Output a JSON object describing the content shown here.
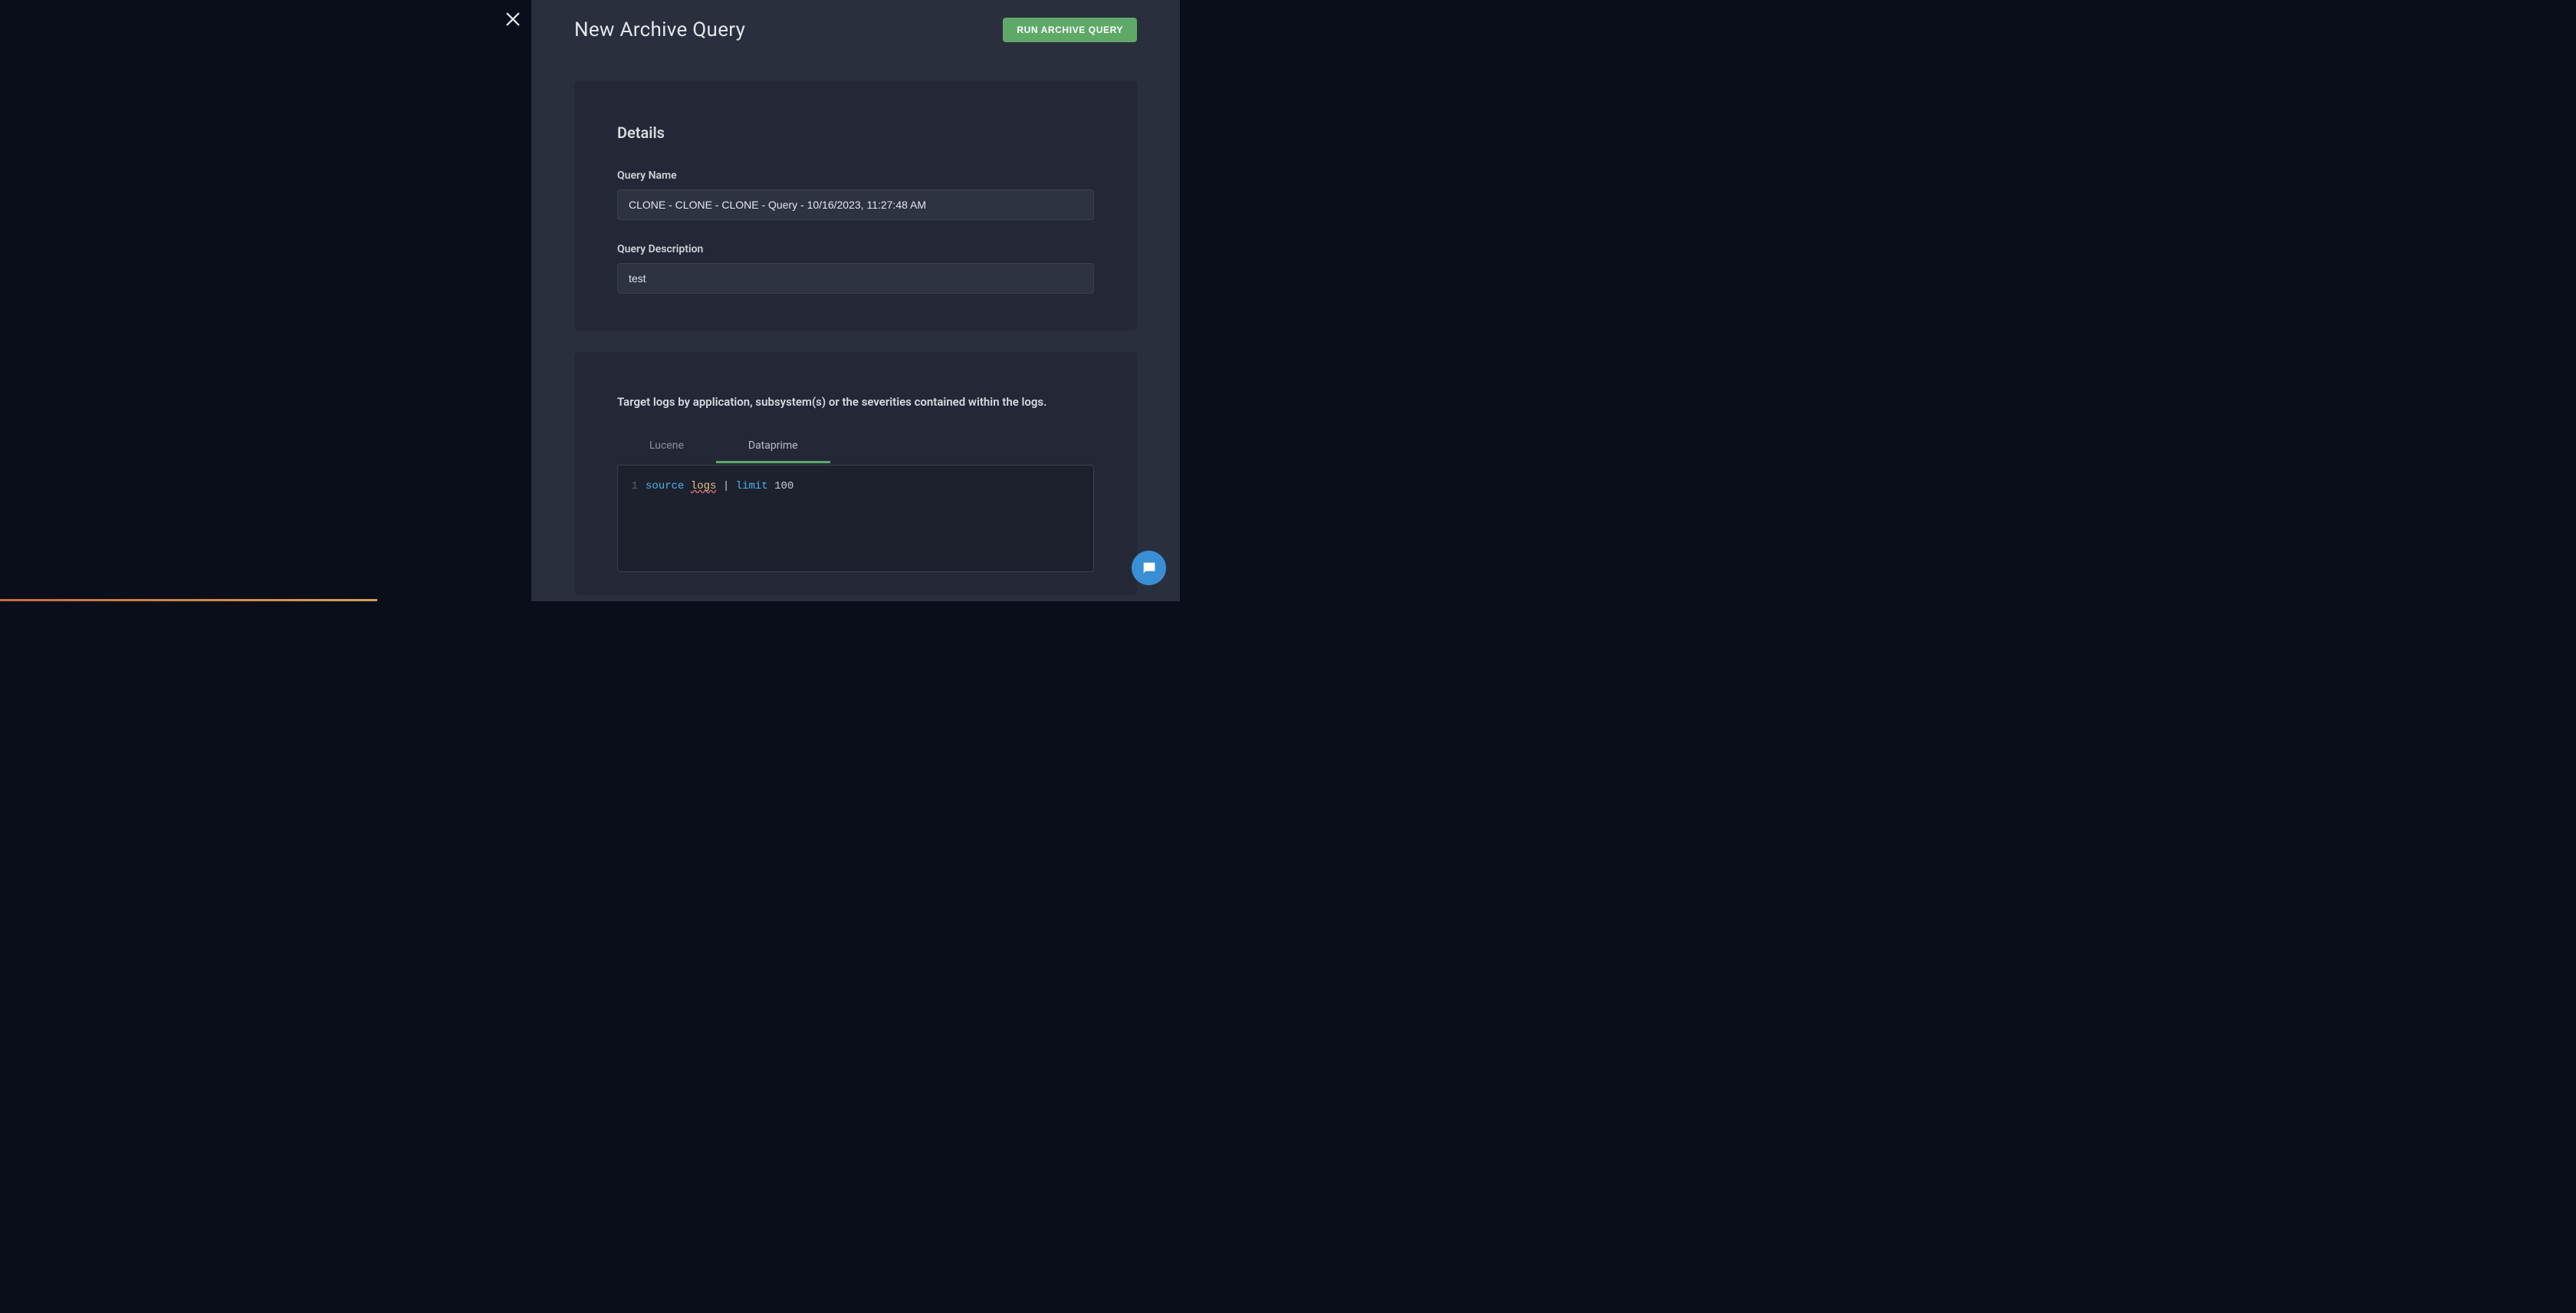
{
  "header": {
    "title": "New Archive Query",
    "run_button_label": "RUN ARCHIVE QUERY"
  },
  "details": {
    "section_title": "Details",
    "query_name_label": "Query Name",
    "query_name_value": "CLONE - CLONE - CLONE - Query - 10/16/2023, 11:27:48 AM",
    "query_description_label": "Query Description",
    "query_description_value": "test"
  },
  "filter": {
    "heading": "Target logs by application, subsystem(s) or the severities contained within the logs.",
    "tabs": [
      {
        "label": "Lucene",
        "active": false
      },
      {
        "label": "Dataprime",
        "active": true
      }
    ],
    "code": {
      "line_number": "1",
      "tokens": {
        "source": "source",
        "logs": "logs",
        "pipe": "|",
        "limit": "limit",
        "value": "100"
      }
    }
  },
  "icons": {
    "close": "close-icon",
    "chat": "chat-icon"
  }
}
